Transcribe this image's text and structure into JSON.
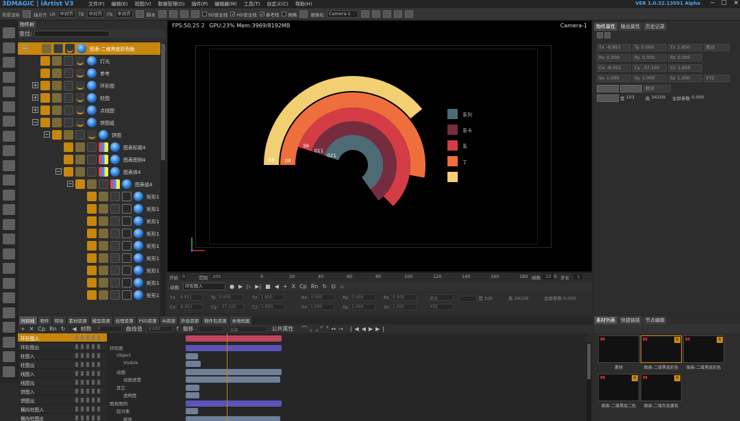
{
  "app": {
    "brand": "3DMAGIC | iArtist V3",
    "menus": [
      "文件(F)",
      "编辑(E)",
      "视图(V)",
      "数据管理(D)",
      "插件(P)",
      "编辑器(M)",
      "工具(T)",
      "自定义(C)",
      "帮助(H)"
    ],
    "version": "VER 1.0.32.13091 Alpha"
  },
  "toolbar": {
    "bg_label": "背景渲染",
    "align_label": "轴对齐",
    "lr": "LR",
    "lr_value": "中对齐",
    "tb": "TB",
    "tb_value": "中对齐",
    "fb": "FB",
    "fb_value": "中对齐",
    "script_label": "脚本",
    "sd_safe": "SD安全线",
    "hd_safe": "HD安全线",
    "ref_line": "参考线",
    "grid": "网格",
    "camera_label": "摄像机",
    "camera_value": "Camera-1"
  },
  "object_panel": {
    "tab": "物件树",
    "search_label": "查找:",
    "items": [
      {
        "name": "图表-二维黑底彩色版",
        "level": 0,
        "expand": "−",
        "selected": true
      },
      {
        "name": "灯光",
        "level": 1
      },
      {
        "name": "参考",
        "level": 1
      },
      {
        "name": "环形图",
        "level": 1,
        "expand": "+"
      },
      {
        "name": "柱图",
        "level": 1,
        "expand": "+"
      },
      {
        "name": "点线图",
        "level": 1,
        "expand": "+"
      },
      {
        "name": "饼图组",
        "level": 1,
        "expand": "−"
      },
      {
        "name": "饼图",
        "level": 2,
        "expand": "−"
      },
      {
        "name": "图表标题4",
        "level": 3
      },
      {
        "name": "图表图例4",
        "level": 3
      },
      {
        "name": "图表体4",
        "level": 3,
        "expand": "−"
      },
      {
        "name": "图表组4",
        "level": 4,
        "expand": "−"
      },
      {
        "name": "矩形1",
        "level": 5
      },
      {
        "name": "矩形1",
        "level": 5
      },
      {
        "name": "矩形1",
        "level": 5
      },
      {
        "name": "矩形1",
        "level": 5
      },
      {
        "name": "矩形1",
        "level": 5
      },
      {
        "name": "矩形1",
        "level": 5
      },
      {
        "name": "矩形1",
        "level": 5
      },
      {
        "name": "矩形1",
        "level": 5
      },
      {
        "name": "矩形1",
        "level": 5
      }
    ]
  },
  "viewport": {
    "fps": "FPS:50.25",
    "fps_count": "2",
    "gpu": "GPU:23% Mem:3969/8192MB",
    "camera": "Camera-1"
  },
  "chart_data": {
    "type": "pie",
    "subtype": "concentric-arcs",
    "rings": [
      {
        "label": "68",
        "color": "#f2cf72",
        "fraction": 0.45
      },
      {
        "label": "08",
        "color": "#ef6f3c",
        "fraction": 0.62
      },
      {
        "label": "56",
        "color": "#d43d45",
        "fraction": 0.68
      },
      {
        "label": "011",
        "color": "#742c3e",
        "fraction": 0.75
      },
      {
        "label": "021",
        "color": "#4d6b74",
        "fraction": 0.72
      }
    ],
    "legend": [
      {
        "label": "系列",
        "color": "#4d6b74"
      },
      {
        "label": "系卡",
        "color": "#742c3e"
      },
      {
        "label": "系",
        "color": "#d43d45"
      },
      {
        "label": "丁",
        "color": "#ef6f3c"
      },
      {
        "label": "",
        "color": "#f2cf72"
      }
    ]
  },
  "timeline_ruler": {
    "start_label": "开始",
    "start_value": "0",
    "end_label": "范围",
    "end_value": "200",
    "ticks": [
      "0",
      "20",
      "40",
      "60",
      "80",
      "100",
      "120",
      "140",
      "160",
      "180",
      "200"
    ],
    "current_frame": "13",
    "frame_label": "帧数",
    "step_label": "步长",
    "step_value": "1"
  },
  "playback": {
    "anim_label": "动画",
    "anim_value": "环形图入",
    "tools": [
      "X",
      "Cp",
      "Rn"
    ]
  },
  "transform_bar": {
    "tx": "Tx",
    "tx_v": "-8.951",
    "ty": "Ty",
    "ty_v": "0.000",
    "tz": "Tz",
    "tz_v": "1.850",
    "rx": "Rx",
    "rx_v": "0.000",
    "ry": "Ry",
    "ry_v": "0.000",
    "rz": "Rz",
    "rz_v": "0.000",
    "cx": "Cx",
    "cx_v": "-8.951",
    "cy": "Cy",
    "cy_v": "-37.105",
    "cz": "Cz",
    "cz_v": "1.850",
    "sx": "Sx",
    "sx_v": "1.000",
    "sy": "Sy",
    "sy_v": "1.000",
    "sz": "Sz",
    "sz_v": "1.000",
    "mode": "绝对",
    "order": "XYZ",
    "w_label": "宽",
    "w_value": "100",
    "h_label": "高",
    "h_value": "34109",
    "global": "全屏参数",
    "global_v": "0.000"
  },
  "right_panel": {
    "tabs": [
      "物件属性",
      "输出属性",
      "历史记录"
    ],
    "rows": [
      [
        [
          "Tx",
          "-8.951"
        ],
        [
          "Ty",
          "0.000"
        ],
        [
          "Tz",
          "1.850"
        ]
      ],
      [
        [
          "Rx",
          "0.000"
        ],
        [
          "Ry",
          "0.000"
        ],
        [
          "Rz",
          "0.000"
        ]
      ],
      [
        [
          "Cx",
          "-8.951"
        ],
        [
          "Cy",
          "-37.105"
        ],
        [
          "Cz",
          "1.850"
        ]
      ],
      [
        [
          "Sx",
          "1.000"
        ],
        [
          "Sy",
          "1.000"
        ],
        [
          "Sz",
          "1.000"
        ]
      ]
    ],
    "mode": "绝对",
    "order": "XYZ",
    "w_label": "宽",
    "w_value": "103",
    "h_label": "高",
    "h_value": "34109",
    "global": "全屏参数",
    "global_v": "0.000"
  },
  "bottom_tabs": [
    "时间线",
    "物件",
    "特效",
    "素材资源",
    "模型资源",
    "纹理资源",
    "PSD资源",
    "AI资源",
    "声音资源",
    "物件包资源",
    "本地档案"
  ],
  "timeline_tools": {
    "frame_label": "帧数",
    "frame_value": "0",
    "curve_label": "曲线值",
    "curve_value": "0.000",
    "offset_label": "偏移",
    "all_label": "全部",
    "public_label": "公共属性"
  },
  "anim_list": [
    "环形图入",
    "环形图出",
    "柱图入",
    "柱图出",
    "线图入",
    "线图出",
    "饼图入",
    "饼图出",
    "横向柱图入",
    "横向柱图出"
  ],
  "tracks": [
    {
      "label": "环形图",
      "indent": 0
    },
    {
      "label": "Object",
      "indent": 1
    },
    {
      "label": "Visible",
      "indent": 2
    },
    {
      "label": "动画",
      "indent": 1
    },
    {
      "label": "动画进度",
      "indent": 2
    },
    {
      "label": "其它",
      "indent": 1
    },
    {
      "label": "透明度",
      "indent": 2
    },
    {
      "label": "图表图例",
      "indent": 0
    },
    {
      "label": "超对象",
      "indent": 1
    },
    {
      "label": "缩放",
      "indent": 2
    }
  ],
  "library": {
    "tabs": [
      "素材列表",
      "快捷链接",
      "节点编辑"
    ],
    "items": [
      {
        "caption": "素材",
        "badge_m": "M",
        "badge_r": ""
      },
      {
        "caption": "图表-二维黑底彩色",
        "badge_m": "M",
        "badge_r": "R",
        "selected": true
      },
      {
        "caption": "图表-二维黑底彩色",
        "badge_m": "M",
        "badge_r": "R"
      },
      {
        "caption": "图表-二维黑底二色",
        "badge_m": "M",
        "badge_r": "R"
      },
      {
        "caption": "图表-二维灰底黄色",
        "badge_m": "M",
        "badge_r": "R"
      }
    ]
  }
}
